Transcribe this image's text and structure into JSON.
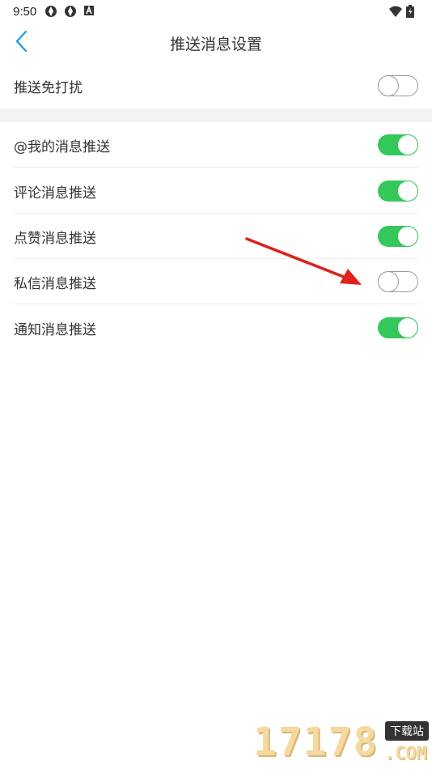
{
  "status_bar": {
    "time": "9:50",
    "icons_left": [
      "shutter-icon",
      "shutter-icon",
      "a-box-icon"
    ],
    "icons_right": [
      "wifi-icon",
      "battery-icon"
    ]
  },
  "nav": {
    "title": "推送消息设置",
    "back_icon": "chevron-left-icon",
    "accent": "#1ea0e6"
  },
  "dnd_row": {
    "label": "推送免打扰",
    "enabled": false
  },
  "rows": [
    {
      "label": "@我的消息推送",
      "enabled": true
    },
    {
      "label": "评论消息推送",
      "enabled": true
    },
    {
      "label": "点赞消息推送",
      "enabled": true
    },
    {
      "label": "私信消息推送",
      "enabled": false
    },
    {
      "label": "通知消息推送",
      "enabled": true
    }
  ],
  "colors": {
    "toggle_on": "#34c759",
    "toggle_off_border": "#9a9a9a",
    "section_gap": "#f3f3f5",
    "annotation_arrow": "#e0201a"
  },
  "watermark": {
    "digits": "17178",
    "badge": "下载站",
    "suffix": ".COM"
  }
}
